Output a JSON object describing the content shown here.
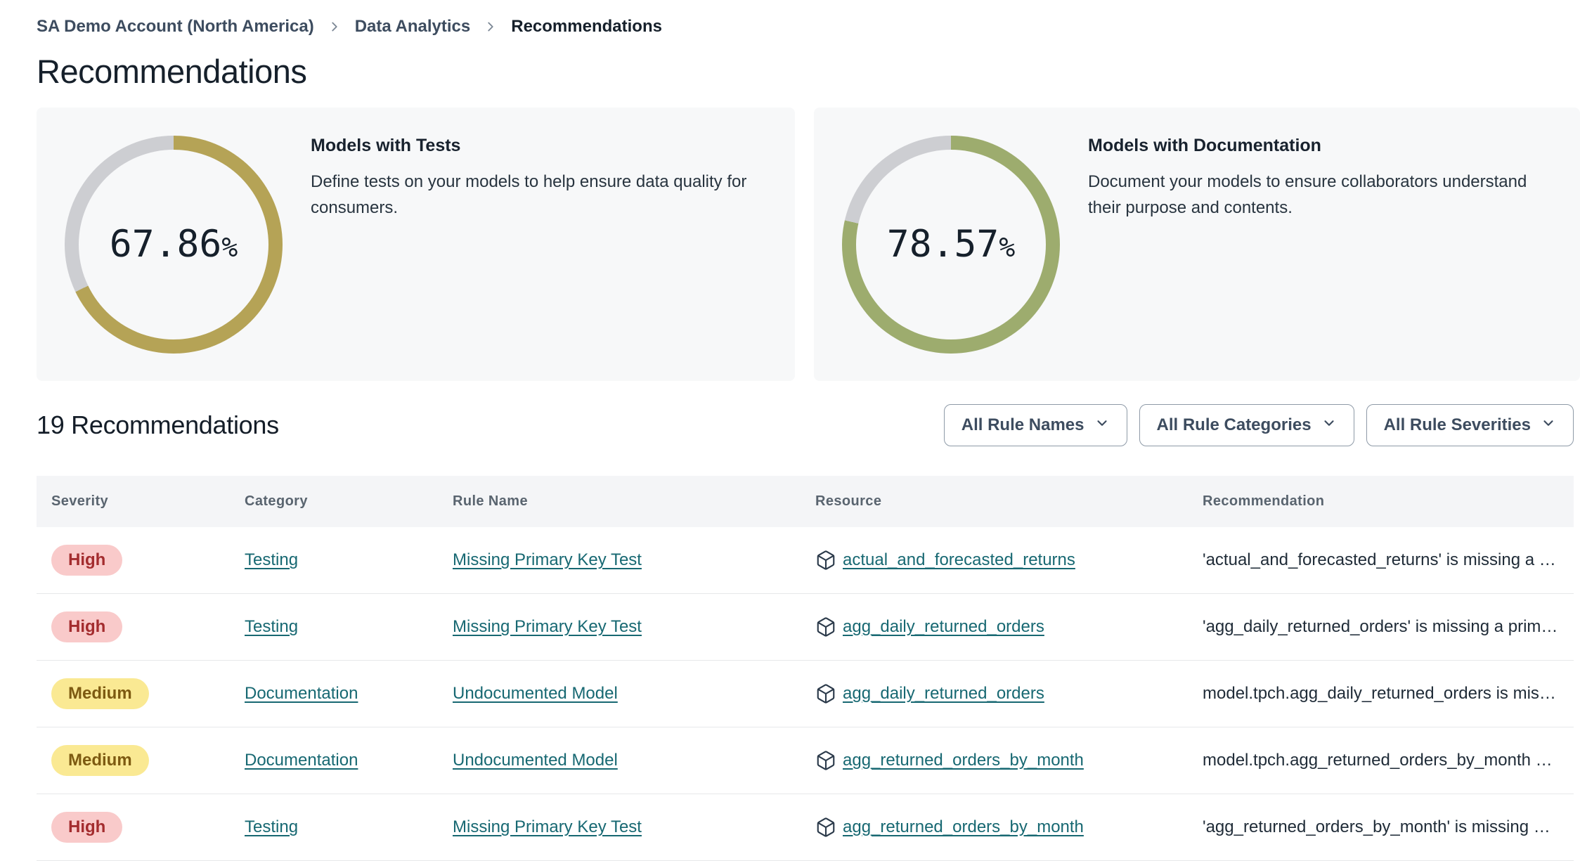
{
  "breadcrumb": {
    "items": [
      {
        "label": "SA Demo Account (North America)"
      },
      {
        "label": "Data Analytics"
      },
      {
        "label": "Recommendations"
      }
    ]
  },
  "page_title": "Recommendations",
  "cards": [
    {
      "title": "Models with Tests",
      "description": "Define tests on your models to help ensure data quality for consumers.",
      "percent": "67.86",
      "percent_suffix": "%",
      "color": "#b5a356"
    },
    {
      "title": "Models with Documentation",
      "description": "Document your models to ensure collaborators understand their purpose and contents.",
      "percent": "78.57",
      "percent_suffix": "%",
      "color": "#9dac6e"
    }
  ],
  "list_header": {
    "title": "19 Recommendations",
    "filters": [
      "All Rule Names",
      "All Rule Categories",
      "All Rule Severities"
    ]
  },
  "table": {
    "columns": [
      "Severity",
      "Category",
      "Rule Name",
      "Resource",
      "Recommendation"
    ],
    "rows": [
      {
        "severity": "High",
        "category": "Testing",
        "rule_name": "Missing Primary Key Test",
        "resource": "actual_and_forecasted_returns",
        "recommendation": "'actual_and_forecasted_returns' is missing a …"
      },
      {
        "severity": "High",
        "category": "Testing",
        "rule_name": "Missing Primary Key Test",
        "resource": "agg_daily_returned_orders",
        "recommendation": "'agg_daily_returned_orders' is missing a prim…"
      },
      {
        "severity": "Medium",
        "category": "Documentation",
        "rule_name": "Undocumented Model",
        "resource": "agg_daily_returned_orders",
        "recommendation": "model.tpch.agg_daily_returned_orders is mis…"
      },
      {
        "severity": "Medium",
        "category": "Documentation",
        "rule_name": "Undocumented Model",
        "resource": "agg_returned_orders_by_month",
        "recommendation": "model.tpch.agg_returned_orders_by_month …"
      },
      {
        "severity": "High",
        "category": "Testing",
        "rule_name": "Missing Primary Key Test",
        "resource": "agg_returned_orders_by_month",
        "recommendation": "'agg_returned_orders_by_month' is missing …"
      }
    ]
  },
  "colors": {
    "accent_tests": "#b5a356",
    "accent_docs": "#9dac6e",
    "donut_track": "#cdced2",
    "link": "#176872",
    "severity_high_bg": "#f9caca",
    "severity_high_text": "#a32c2e",
    "severity_medium_bg": "#fae993",
    "severity_medium_text": "#7d5a11"
  }
}
